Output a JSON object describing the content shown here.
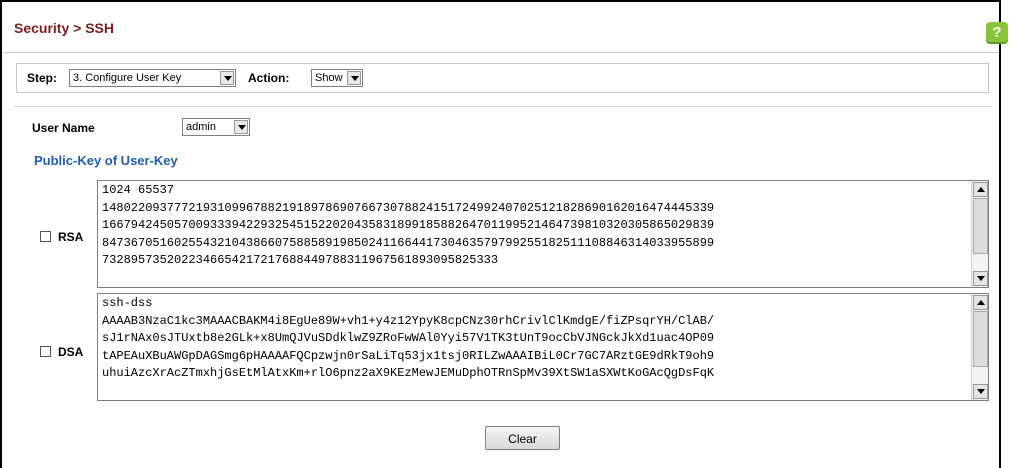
{
  "header": {
    "title": "Security > SSH",
    "help_glyph": "?"
  },
  "toolbar": {
    "step_label": "Step:",
    "step_value": "3. Configure User Key",
    "action_label": "Action:",
    "action_value": "Show"
  },
  "form": {
    "user_name_label": "User Name",
    "user_name_value": "admin",
    "section_title": "Public-Key of User-Key",
    "rsa_label": "RSA",
    "rsa_checked": false,
    "rsa_key": "1024 65537\n1480220937772193109967882191897869076673078824151724992407025121828690162016474445339\n1667942450570093339422932545152202043583189918588264701199521464739810320305865029839\n8473670516025543210438660758858919850241166441730463579799255182511108846314033955899\n7328957352022346654217217688449788311967561893095825333",
    "dsa_label": "DSA",
    "dsa_checked": false,
    "dsa_key": "ssh-dss\nAAAAB3NzaC1kc3MAAACBAKM4i8EgUe89W+vh1+y4z12YpyK8cpCNz30rhCrivlClKmdgE/fiZPsqrYH/ClAB/\nsJ1rNAx0sJTUxtb8e2GLk+x8UmQJVuSDdklwZ9ZRoFwWAl0Yyi57V1TK3tUnT9ocCbVJNGckJkXd1uac4OP09\ntAPEAuXBuAWGpDAGSmg6pHAAAAFQCpzwjn0rSaLiTq53jx1tsj0RILZwAAAIBiL0Cr7GC7ARztGE9dRkT9oh9\nuhuiAzcXrAcZTmxhjGsEtMlAtxKm+rlO6pnz2aX9KEzMewJEMuDphOTRnSpMv39XtSW1aSXWtKoGAcQgDsFqK"
  },
  "buttons": {
    "clear_label": "Clear"
  },
  "icons": {
    "help": "help-icon",
    "dropdown": "chevron-down-icon",
    "scroll_up": "scroll-up-icon",
    "scroll_down": "scroll-down-icon"
  },
  "colors": {
    "title": "#7a1f1f",
    "section_title": "#1f5fa8",
    "help_badge": "#8ac43f"
  }
}
